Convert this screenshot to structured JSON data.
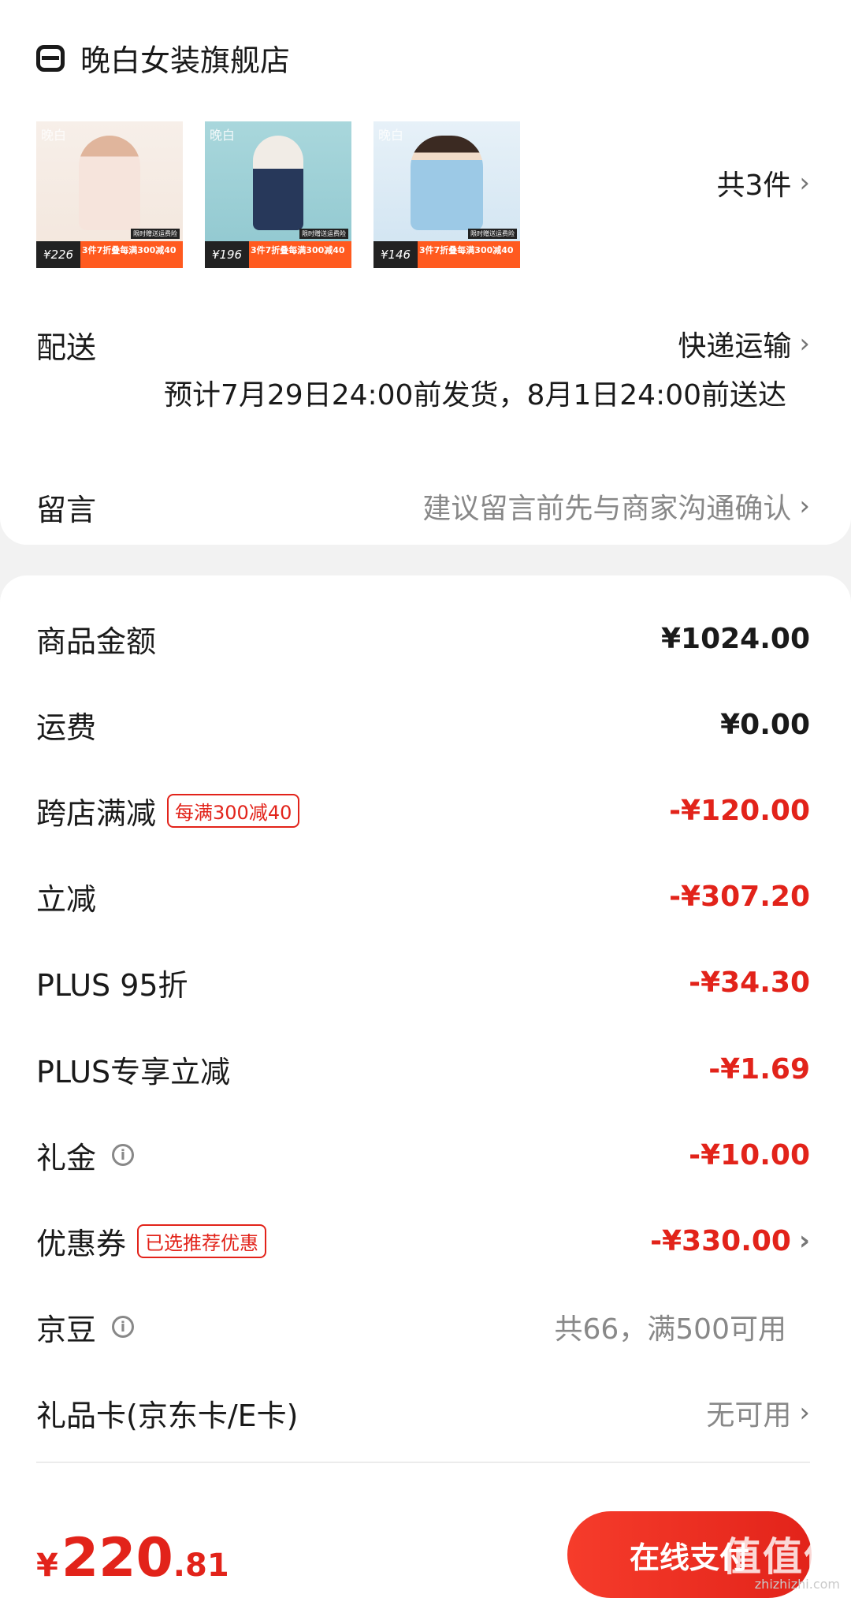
{
  "store": {
    "name": "晚白女装旗舰店",
    "count_text": "共3件",
    "products": [
      {
        "brand": "晚白",
        "price": "¥226",
        "promo": "3件7折叠每满300减40",
        "tag": "限时赠送运费险",
        "colors": [
          "#f3e6dc",
          "#e9c9b5",
          "#f7efe9"
        ]
      },
      {
        "brand": "晚白",
        "price": "¥196",
        "promo": "3件7折叠每满300减40",
        "tag": "限时赠送运费险",
        "colors": [
          "#9fd2d8",
          "#27385a",
          "#eef4f5"
        ]
      },
      {
        "brand": "晚白",
        "price": "¥146",
        "promo": "3件7折叠每满300减40",
        "tag": "限时赠送运费险",
        "colors": [
          "#9cc9e6",
          "#bcd9ef",
          "#e7f1f8"
        ]
      }
    ]
  },
  "delivery": {
    "label": "配送",
    "method": "快递运输",
    "estimate": "预计7月29日24:00前发货，8月1日24:00前送达"
  },
  "message": {
    "label": "留言",
    "placeholder": "建议留言前先与商家沟通确认"
  },
  "summary": {
    "goods_amount": {
      "label": "商品金额",
      "value": "¥1024.00"
    },
    "shipping": {
      "label": "运费",
      "value": "¥0.00"
    },
    "cross_store": {
      "label": "跨店满减",
      "tag": "每满300减40",
      "value": "-¥120.00"
    },
    "instant": {
      "label": "立减",
      "value": "-¥307.20"
    },
    "plus95": {
      "label": "PLUS 95折",
      "value": "-¥34.30"
    },
    "plus_instant": {
      "label": "PLUS专享立减",
      "value": "-¥1.69"
    },
    "gift_money": {
      "label": "礼金",
      "value": "-¥10.00"
    },
    "coupon": {
      "label": "优惠券",
      "tag": "已选推荐优惠",
      "value": "-¥330.00"
    },
    "jingdou": {
      "label": "京豆",
      "value": "共66，满500可用"
    },
    "gift_card": {
      "label": "礼品卡(京东卡/E卡)",
      "value": "无可用"
    }
  },
  "bottom": {
    "currency": "¥",
    "total_int": "220",
    "total_dec": ".81",
    "pay_label": "在线支付"
  },
  "watermark": {
    "logo": "值值值",
    "site": "zhizhizhi.com"
  },
  "colors": {
    "accent": "#e2231a",
    "background": "#f2f2f2"
  }
}
